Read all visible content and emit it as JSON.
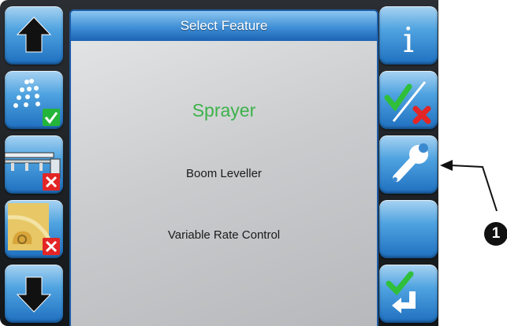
{
  "header": {
    "title": "Select Feature"
  },
  "features": [
    {
      "label": "Sprayer",
      "state": "selected"
    },
    {
      "label": "Boom Leveller",
      "state": "normal"
    },
    {
      "label": "Variable Rate Control",
      "state": "normal"
    }
  ],
  "left_buttons": [
    {
      "icon": "arrow-up-icon"
    },
    {
      "icon": "sprayer-nozzle-icon",
      "status": "enabled"
    },
    {
      "icon": "boom-icon",
      "status": "disabled"
    },
    {
      "icon": "field-map-icon",
      "status": "disabled"
    },
    {
      "icon": "arrow-down-icon"
    }
  ],
  "right_buttons": [
    {
      "icon": "info-icon"
    },
    {
      "icon": "enable-disable-icon"
    },
    {
      "icon": "wrench-icon"
    },
    {
      "icon": "blank"
    },
    {
      "icon": "confirm-return-icon"
    }
  ],
  "callout": {
    "number": "1"
  },
  "colors": {
    "button_blue": "#1e6fbf",
    "selected_text": "#3cb24a",
    "check_green": "#23b53a",
    "cross_red": "#e32525"
  }
}
